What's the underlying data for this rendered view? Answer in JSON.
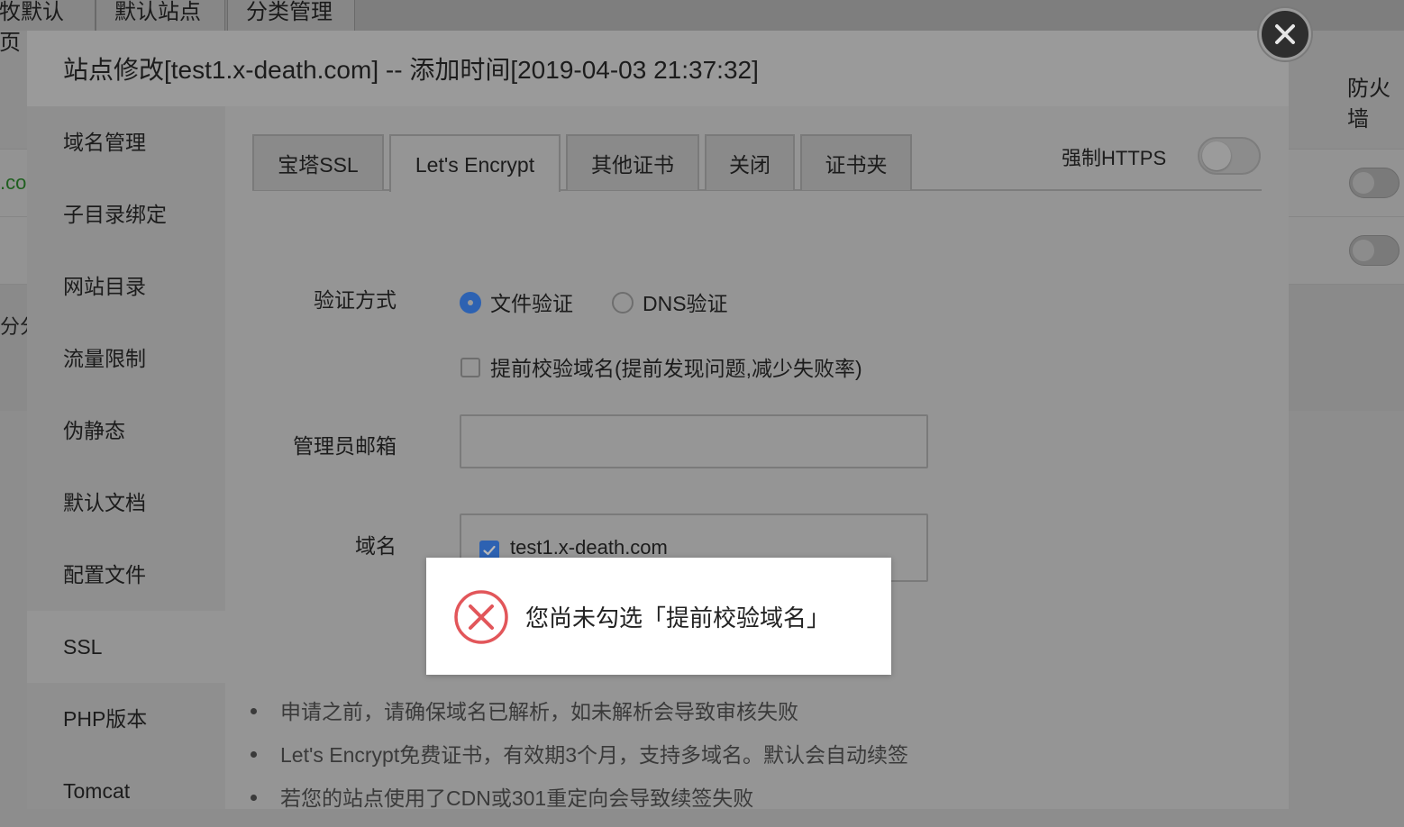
{
  "background": {
    "tabs": [
      "牧默认页",
      "默认站点",
      "分类管理"
    ],
    "right_label": "防火墙",
    "left_fragments": [
      ".co",
      "分分"
    ]
  },
  "modal": {
    "title": "站点修改[test1.x-death.com] -- 添加时间[2019-04-03 21:37:32]",
    "close_icon": "close-icon",
    "side_menu": [
      "域名管理",
      "子目录绑定",
      "网站目录",
      "流量限制",
      "伪静态",
      "默认文档",
      "配置文件",
      "SSL",
      "PHP版本",
      "Tomcat"
    ],
    "active_menu_index": 7,
    "ssl_tabs": [
      "宝塔SSL",
      "Let's Encrypt",
      "其他证书",
      "关闭",
      "证书夹"
    ],
    "active_tab_index": 1,
    "force_https_label": "强制HTTPS",
    "force_https_enabled": false,
    "form": {
      "verify_label": "验证方式",
      "verify_options": [
        "文件验证",
        "DNS验证"
      ],
      "verify_selected": "文件验证",
      "precheck_label": "提前校验域名(提前发现问题,减少失败率)",
      "precheck_checked": false,
      "email_label": "管理员邮箱",
      "email_value": "",
      "domain_label": "域名",
      "domains": [
        {
          "name": "test1.x-death.com",
          "checked": true
        }
      ]
    },
    "toast": {
      "icon": "error-x-icon",
      "message": "您尚未勾选「提前校验域名」"
    },
    "notes": [
      "申请之前，请确保域名已解析，如未解析会导致审核失败",
      "Let's Encrypt免费证书，有效期3个月，支持多域名。默认会自动续签",
      "若您的站点使用了CDN或301重定向会导致续签失败"
    ]
  },
  "colors": {
    "accent_blue": "#2d62b2",
    "error_red": "#e2565a",
    "overlay_grey": "#959595"
  }
}
